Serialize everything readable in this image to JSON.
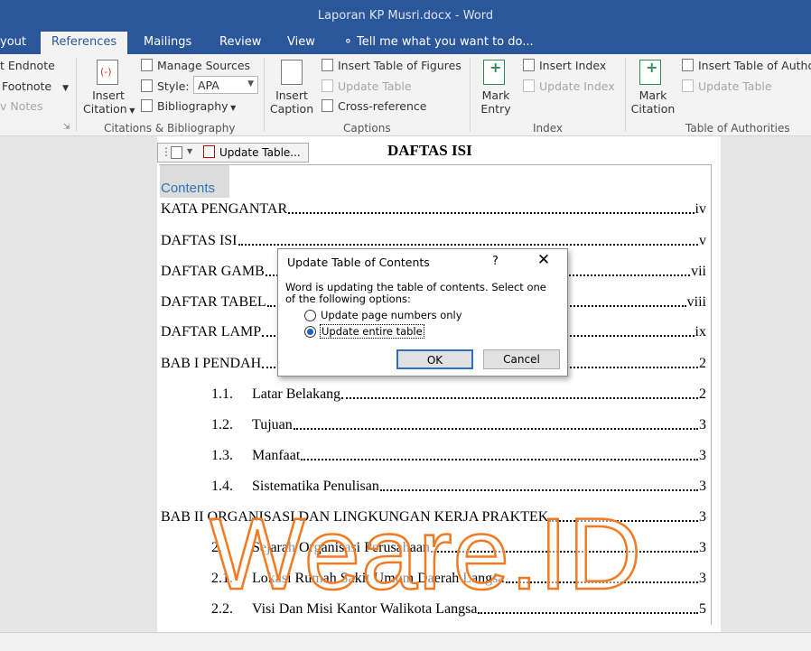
{
  "window": {
    "title": "Laporan KP Musri.docx - Word"
  },
  "tabs": [
    {
      "label": "yout"
    },
    {
      "label": "References"
    },
    {
      "label": "Mailings"
    },
    {
      "label": "Review"
    },
    {
      "label": "View"
    }
  ],
  "tell_me": "Tell me what you want to do...",
  "ribbon": {
    "footnotes": {
      "insert_endnote": "t Endnote",
      "next_footnote": "Footnote",
      "show_notes": "v Notes"
    },
    "citations": {
      "insert_citation": [
        "Insert",
        "Citation"
      ],
      "manage_sources": "Manage Sources",
      "style_label": "Style:",
      "style_value": "APA",
      "bibliography": "Bibliography",
      "group_label": "Citations & Bibliography"
    },
    "captions": {
      "insert_caption": [
        "Insert",
        "Caption"
      ],
      "insert_table_of_figures": "Insert Table of Figures",
      "update_table": "Update Table",
      "cross_reference": "Cross-reference",
      "group_label": "Captions"
    },
    "index": {
      "mark_entry": [
        "Mark",
        "Entry"
      ],
      "insert_index": "Insert Index",
      "update_index": "Update Index",
      "group_label": "Index"
    },
    "authorities": {
      "mark_citation": [
        "Mark",
        "Citation"
      ],
      "insert_table_of_authorities": "Insert Table of Autho",
      "update_table": "Update Table",
      "group_label": "Table of Authorities"
    }
  },
  "toc_control": {
    "update_table_button": "Update Table..."
  },
  "document": {
    "heading": "DAFTAS ISI",
    "contents_label": "Contents",
    "entries": [
      {
        "num": "",
        "text": "KATA PENGANTAR",
        "page": "iv"
      },
      {
        "num": "",
        "text": "DAFTAS ISI",
        "page": "v"
      },
      {
        "num": "",
        "text": "DAFTAR GAMB",
        "page": "vii"
      },
      {
        "num": "",
        "text": "DAFTAR TABEL",
        "page": "viii"
      },
      {
        "num": "",
        "text": "DAFTAR LAMP",
        "page": "ix"
      },
      {
        "num": "",
        "text": "BAB I  PENDAH",
        "page": "2"
      },
      {
        "num": "1.1.",
        "text": "Latar Belakang",
        "page": "2"
      },
      {
        "num": "1.2.",
        "text": "Tujuan",
        "page": "3"
      },
      {
        "num": "1.3.",
        "text": "Manfaat",
        "page": "3"
      },
      {
        "num": "1.4.",
        "text": "Sistematika Penulisan",
        "page": "3"
      },
      {
        "num": "",
        "text": "BAB II  ORGANISASI DAN LINGKUNGAN KERJA PRAKTEK",
        "page": "3"
      },
      {
        "num": "2.",
        "text": "Sejarah Organisasi Perusahaan",
        "page": "3"
      },
      {
        "num": "2.1.",
        "text": "Lokasi Rumah Sakit Umum Daerah Langsa",
        "page": "3"
      },
      {
        "num": "2.2.",
        "text": "Visi Dan Misi Kantor Walikota Langsa",
        "page": "5"
      }
    ]
  },
  "dialog": {
    "title": "Update Table of Contents",
    "help": "?",
    "message_line1": "Word is updating the table of contents.  Select one",
    "message_line2": "of the following options:",
    "options": [
      {
        "label": "Update page numbers only",
        "selected": false
      },
      {
        "label": "Update entire table",
        "selected": true
      }
    ],
    "ok": "OK",
    "cancel": "Cancel"
  },
  "watermark": "Weare.ID",
  "colors": {
    "word_blue": "#2b579a",
    "watermark_orange": "#f07b22",
    "heading_blue": "#2e74b5"
  }
}
